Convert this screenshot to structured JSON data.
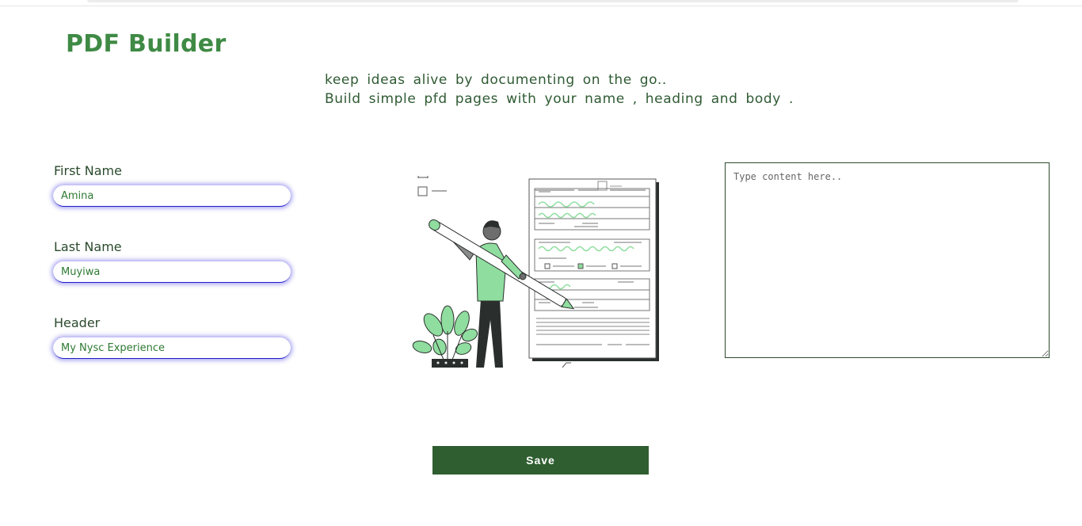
{
  "app": {
    "title": "PDF Builder",
    "tagline_line1": "keep ideas alive by documenting on the go..",
    "tagline_line2": "Build simple pfd pages with your name , heading and body ."
  },
  "form": {
    "first_name": {
      "label": "First Name",
      "value": "Amina"
    },
    "last_name": {
      "label": "Last Name",
      "value": "Muyiwa"
    },
    "header": {
      "label": "Header",
      "value": "My Nysc Experience"
    }
  },
  "content": {
    "placeholder": "Type content here..",
    "value": ""
  },
  "actions": {
    "save_label": "Save"
  },
  "colors": {
    "brand_green": "#3f8a45",
    "button_green": "#2f5e30",
    "accent_mint": "#8fdd9f",
    "input_glow": "#3c32dc"
  },
  "icons": {
    "illustration": "person-writing-document-illustration"
  }
}
